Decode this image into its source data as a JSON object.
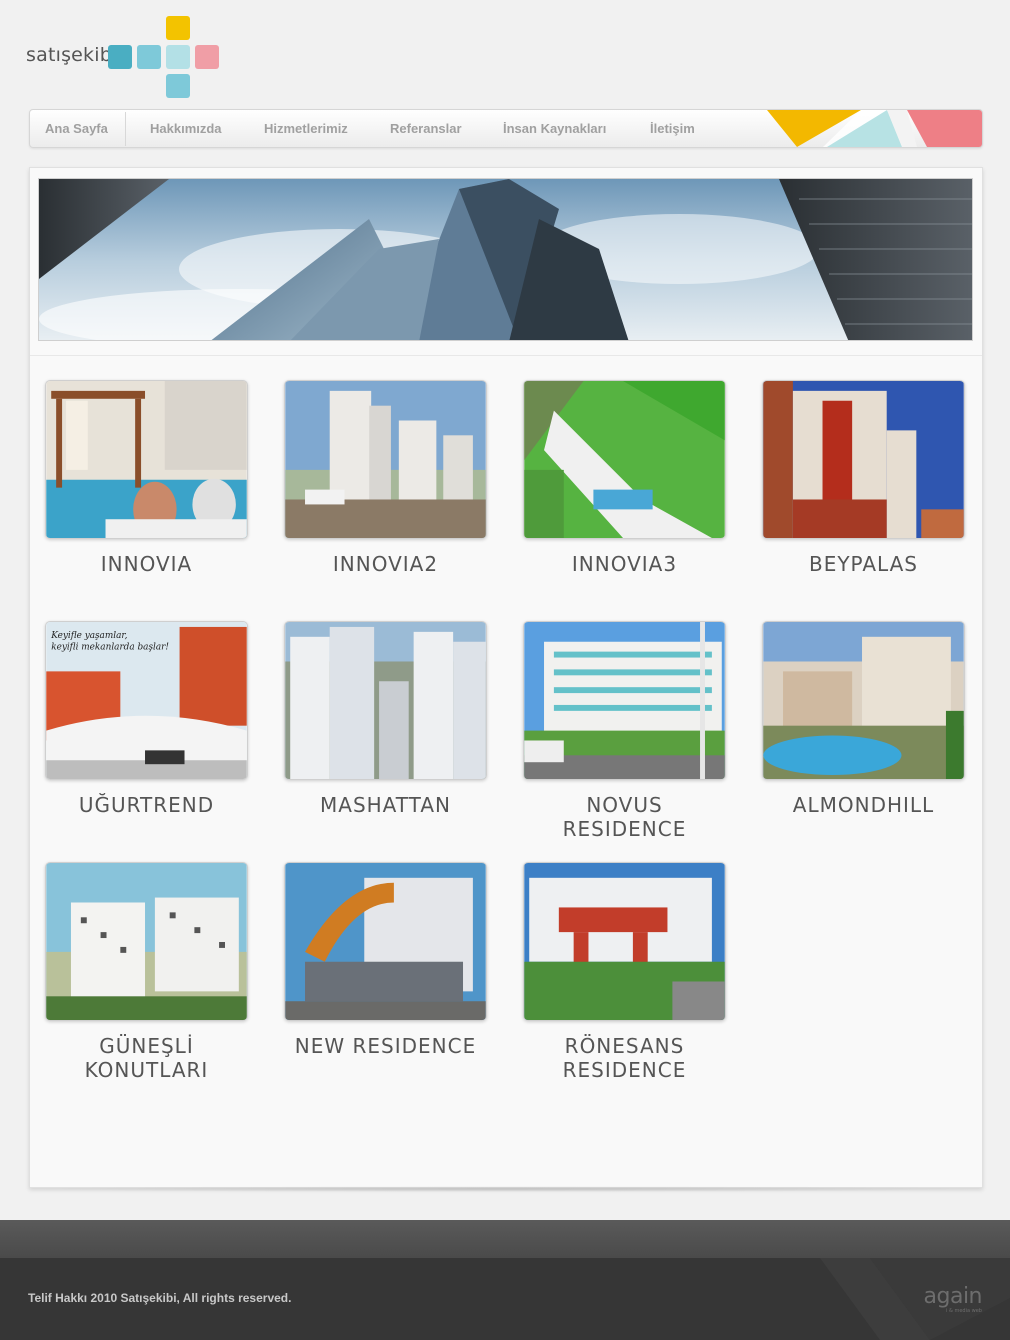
{
  "logo": {
    "text": "satışekibi"
  },
  "nav": {
    "items": [
      {
        "label": "Ana Sayfa"
      },
      {
        "label": "Hakkımızda"
      },
      {
        "label": "Hizmetlerimiz"
      },
      {
        "label": "Referanslar"
      },
      {
        "label": "İnsan Kaynakları"
      },
      {
        "label": "İletişim"
      }
    ]
  },
  "projects": [
    {
      "name": "INNOVIA"
    },
    {
      "name": "INNOVIA2"
    },
    {
      "name": "INNOVIA3"
    },
    {
      "name": "BEYPALAS"
    },
    {
      "name": "UĞURTREND"
    },
    {
      "name": "MASHATTAN"
    },
    {
      "name": "NOVUS RESIDENCE"
    },
    {
      "name": "ALMONDHILL"
    },
    {
      "name": "GÜNEŞLİ KONUTLARI"
    },
    {
      "name": "NEW RESIDENCE"
    },
    {
      "name": "RÖNESANS RESIDENCE"
    }
  ],
  "footer": {
    "copyright": "Telif Hakkı 2010 Satışekibi, All rights reserved.",
    "brand": "again",
    "brand_sub": "i & media web"
  },
  "colors": {
    "logo_teal": "#4aaec2",
    "logo_light_teal": "#7ec9d9",
    "logo_pale_teal": "#b3e0e6",
    "logo_yellow": "#f3c300",
    "logo_pink": "#f09ea6",
    "nav_text": "#a0a0a0",
    "footer_bg": "#363636"
  }
}
